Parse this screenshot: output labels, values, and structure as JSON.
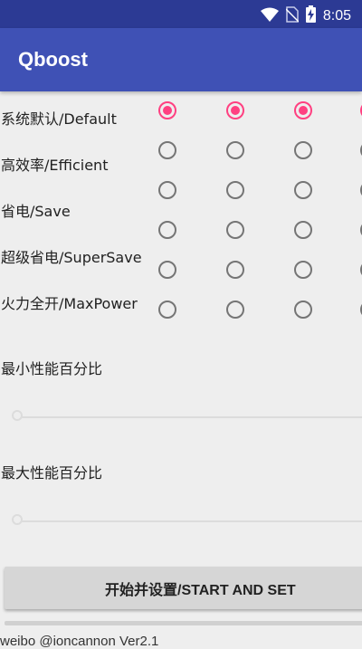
{
  "status_bar": {
    "time": "8:05",
    "icons": [
      "wifi-icon",
      "no-sim-icon",
      "battery-charging-icon"
    ]
  },
  "app_bar": {
    "title": "Qboost"
  },
  "modes": [
    {
      "label": "系统默认/Default",
      "selected": [
        true,
        true,
        true,
        true
      ]
    },
    {
      "label": "高效率/Efficient",
      "selected": [
        false,
        false,
        false,
        false
      ]
    },
    {
      "label": "省电/Save",
      "selected": [
        false,
        false,
        false,
        false
      ]
    },
    {
      "label": "超级省电/SuperSave",
      "selected": [
        false,
        false,
        false,
        false
      ]
    },
    {
      "label": "火力全开/MaxPower",
      "selected": [
        false,
        false,
        false,
        false
      ]
    }
  ],
  "sliders": {
    "min_label": "最小性能百分比",
    "min_value": 0,
    "max_label": "最大性能百分比",
    "max_value": 0
  },
  "start_button": {
    "label": "开始并设置/START AND SET"
  },
  "footer": {
    "text": "weibo @ioncannon Ver2.1"
  },
  "colors": {
    "accent": "#ff4081",
    "primary": "#3f51b5",
    "primary_dark": "#2c3a94"
  }
}
